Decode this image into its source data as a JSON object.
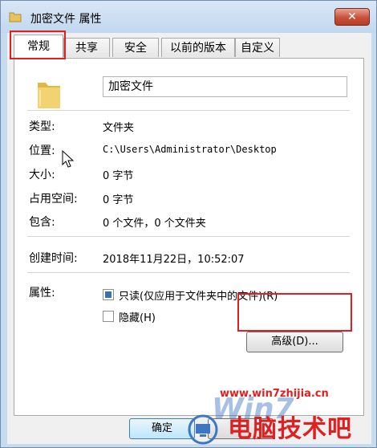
{
  "window": {
    "title": "加密文件 属性",
    "close_label": "✕"
  },
  "tabs": [
    {
      "label": "常规",
      "active": true
    },
    {
      "label": "共享",
      "active": false
    },
    {
      "label": "安全",
      "active": false
    },
    {
      "label": "以前的版本",
      "active": false
    },
    {
      "label": "自定义",
      "active": false
    }
  ],
  "general": {
    "name_value": "加密文件",
    "rows": [
      {
        "label": "类型:",
        "value": "文件夹"
      },
      {
        "label": "位置:",
        "value": "C:\\Users\\Administrator\\Desktop"
      },
      {
        "label": "大小:",
        "value": "0 字节"
      },
      {
        "label": "占用空间:",
        "value": "0 字节"
      },
      {
        "label": "包含:",
        "value": "0 个文件，0 个文件夹"
      },
      {
        "label": "创建时间:",
        "value": "2018年11月22日，10:52:07"
      }
    ],
    "attributes_label": "属性:",
    "readonly_label": "只读(仅应用于文件夹中的文件)(R)",
    "readonly_checked": true,
    "hidden_label": "隐藏(H)",
    "hidden_checked": false,
    "advanced_label": "高级(D)..."
  },
  "footer": {
    "ok_label": "确定"
  },
  "watermark": {
    "url": "www.win7zhijia.cn",
    "text": "电脑技术吧",
    "logo": "Win7"
  },
  "colors": {
    "highlight": "#e02020",
    "accent": "#3d76c4"
  }
}
